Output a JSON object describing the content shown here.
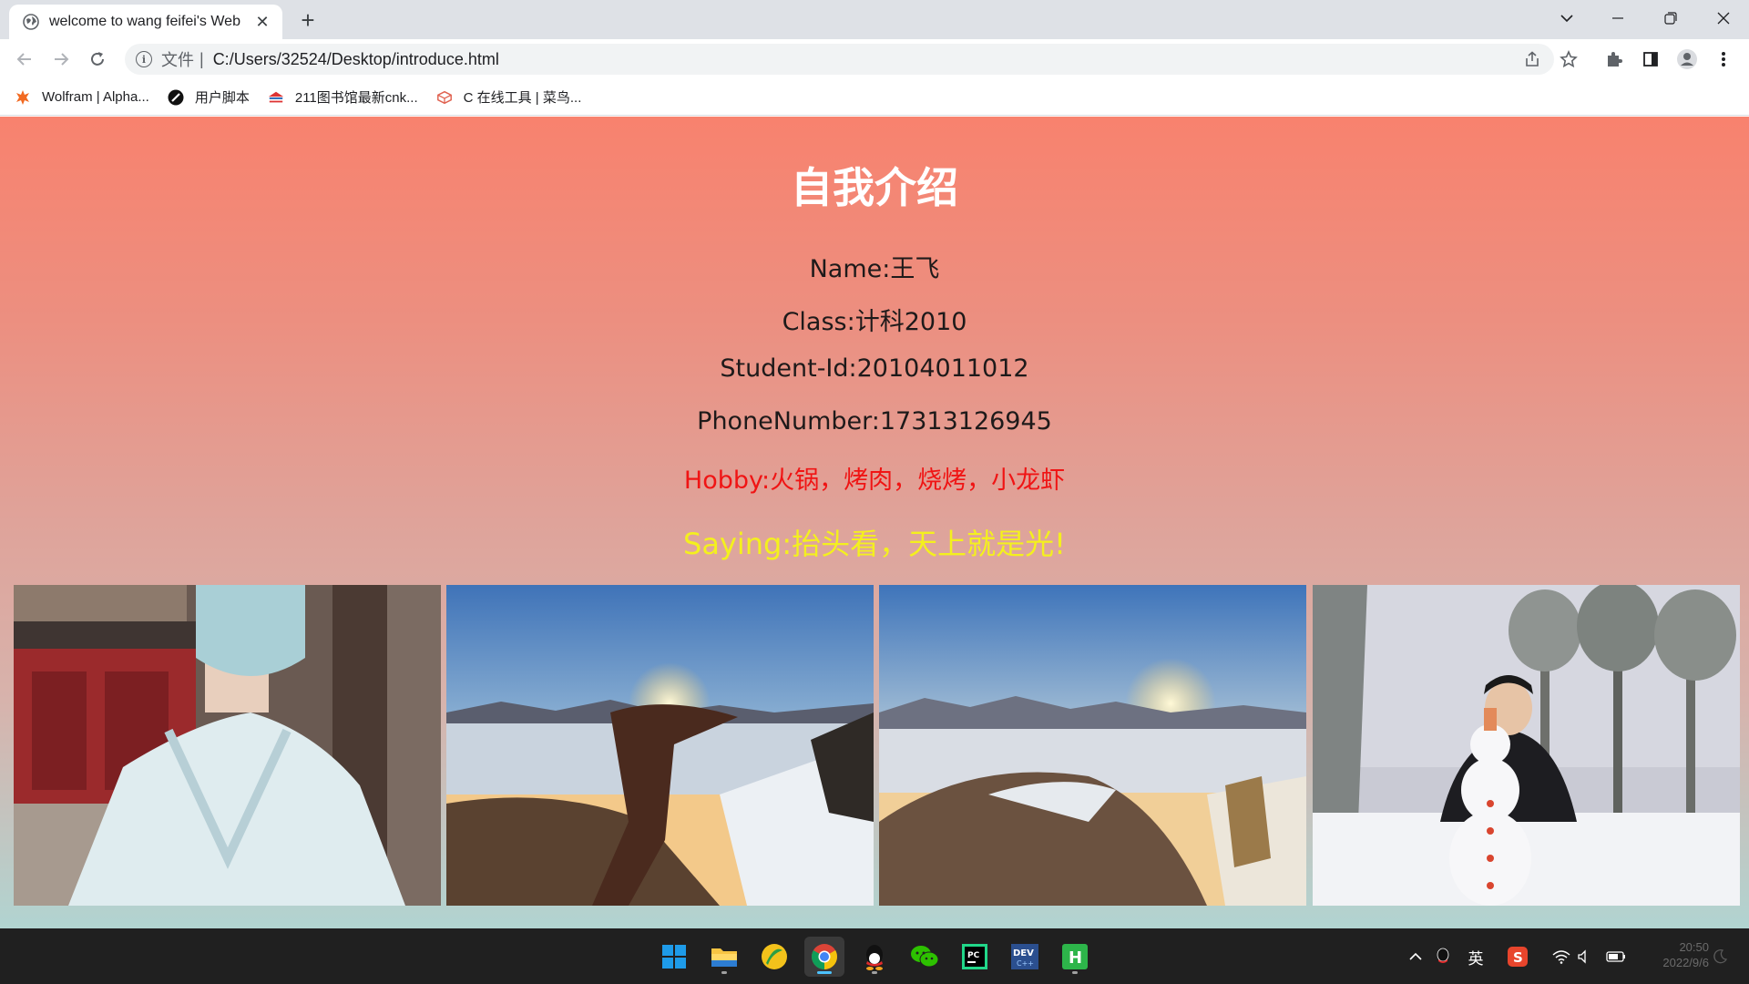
{
  "browser": {
    "tab_title": "welcome to wang feifei's Web",
    "omnibox": {
      "scheme_label": "文件",
      "separator": "|",
      "url": "C:/Users/32524/Desktop/introduce.html"
    },
    "bookmarks": [
      {
        "label": "Wolfram | Alpha...",
        "icon": "wolfram-icon"
      },
      {
        "label": "用户脚本",
        "icon": "userscript-icon"
      },
      {
        "label": "211图书馆最新cnk...",
        "icon": "library-icon"
      },
      {
        "label": "C 在线工具 | 菜鸟...",
        "icon": "runoob-icon"
      }
    ]
  },
  "page": {
    "title": "自我介绍",
    "name": "Name:王飞",
    "class": "Class:计科2010",
    "student_id": "Student-Id:20104011012",
    "phone": "PhoneNumber:17313126945",
    "hobby": "Hobby:火锅，烤肉，烧烤，小龙虾",
    "saying": "Saying:抬头看，天上就是光!",
    "photos": [
      "temple-selfie-photo",
      "sunrise-hand-photo",
      "sunrise-sea-of-clouds-photo",
      "snowman-photo"
    ]
  },
  "taskbar": {
    "apps": [
      "start-icon",
      "file-explorer-icon",
      "app-icon",
      "chrome-icon",
      "qq-icon",
      "wechat-icon",
      "pycharm-icon",
      "devcpp-icon",
      "hbuilder-icon"
    ],
    "tray": {
      "ime_label": "英",
      "time": "20:50",
      "date": "2022/9/6"
    }
  },
  "colors": {
    "gradient_top": "#f8826e",
    "gradient_bottom": "#b1d4d1",
    "title_color": "#ffffff",
    "hobby_color": "#f01414",
    "saying_color": "#f4f01e"
  }
}
